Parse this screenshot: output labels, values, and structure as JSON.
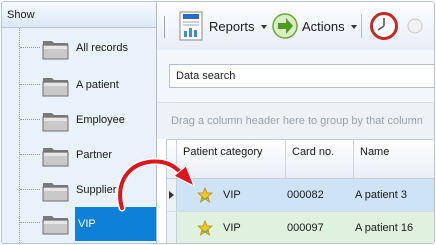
{
  "sidebar": {
    "title": "Show",
    "items": [
      {
        "label": "All records"
      },
      {
        "label": "A patient"
      },
      {
        "label": "Employee"
      },
      {
        "label": "Partner"
      },
      {
        "label": "Supplier"
      },
      {
        "label": "VIP",
        "selected": true
      }
    ]
  },
  "toolbar": {
    "reports_label": "Reports",
    "actions_label": "Actions"
  },
  "search": {
    "placeholder": "Data search"
  },
  "grid": {
    "group_hint": "Drag a column header here to group by that column",
    "columns": [
      "Patient category",
      "Card no.",
      "Name"
    ],
    "rows": [
      {
        "category": "VIP",
        "card": "000082",
        "name": "A patient 3",
        "category_icon": "star-icon"
      },
      {
        "category": "VIP",
        "card": "000097",
        "name": "A patient 16",
        "category_icon": "star-icon"
      }
    ]
  },
  "colors": {
    "selected_bg": "#0f80d8",
    "row_selected_bg": "#cfe3f7",
    "row_alt_bg": "#dff2df",
    "arrow": "#e0141c"
  }
}
